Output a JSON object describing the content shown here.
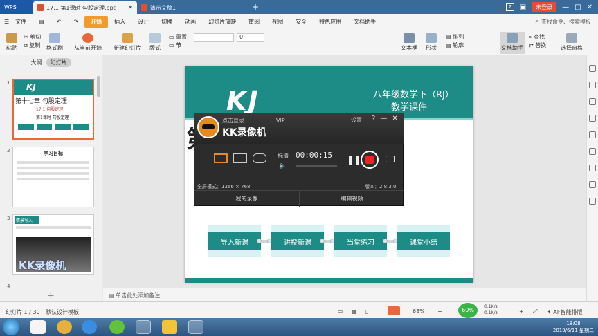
{
  "titlebar": {
    "app": "WPS",
    "tabs": [
      {
        "label": "17.1 第1课时 勾股定理.ppt"
      },
      {
        "label": "演示文稿1"
      }
    ],
    "tab_count_badge": "2",
    "login": "未登录"
  },
  "menubar": {
    "items": [
      "文件",
      "开始",
      "插入",
      "设计",
      "切换",
      "动画",
      "幻灯片放映",
      "审阅",
      "视图",
      "安全",
      "特色应用",
      "文档助手"
    ],
    "search": "查找命令、搜索模板"
  },
  "ribbon": {
    "paste": "粘贴",
    "cut": "剪切",
    "copy": "复制",
    "format_painter": "格式刷",
    "play_from_current": "从当前开始",
    "new_slide": "新建幻灯片",
    "layout": "版式",
    "section": "节",
    "reset": "重置",
    "font_size": "0",
    "textbox": "文本框",
    "shape": "形状",
    "arrange": "排列",
    "outline": "轮廓",
    "doc_helper": "文档助手",
    "find": "查找",
    "replace": "替换",
    "select_pane": "选择窗格"
  },
  "left_pane": {
    "tabs": [
      "大纲",
      "幻灯片"
    ],
    "thumb_numbers": [
      "1",
      "2",
      "3",
      "4"
    ],
    "thumb1": {
      "chapter": "第十七章 勾股定理",
      "section": "17.1 勾股定理",
      "lesson": "第1课时 勾股定理"
    },
    "thumb2": {
      "title": "学习目标"
    },
    "thumb3": {
      "tag": "情景导入",
      "watermark": "KK录像机"
    },
    "add": "+"
  },
  "slide": {
    "logo": "KJ",
    "title_line1": "八年级数学下（RJ）",
    "title_line2": "教学课件",
    "partial_char": "第",
    "steps": [
      "导入新课",
      "讲授新课",
      "当堂练习",
      "课堂小结"
    ]
  },
  "recorder": {
    "login": "点击登录",
    "vip": "VIP",
    "name": "KK录像机",
    "settings": "设置",
    "help": "?",
    "minimize": "—",
    "close": "✕",
    "quality": "标清",
    "timer": "00:00:15",
    "status": "全屏模式：1366 × 768",
    "version": "版本：2.8.3.0",
    "btn_my_recordings": "我的录像",
    "btn_edit_video": "编辑视频"
  },
  "notes": {
    "placeholder": "单击此处添加备注"
  },
  "statusbar": {
    "slide_count": "幻灯片 1 / 30",
    "design": "默认设计模板",
    "zoom": "68%",
    "net": "60%",
    "up": "0.1K/s",
    "down": "0.1K/s",
    "ai": "AI·智能排版"
  },
  "taskbar": {
    "time": "18:08",
    "date": "2019/6/11 星期二"
  }
}
